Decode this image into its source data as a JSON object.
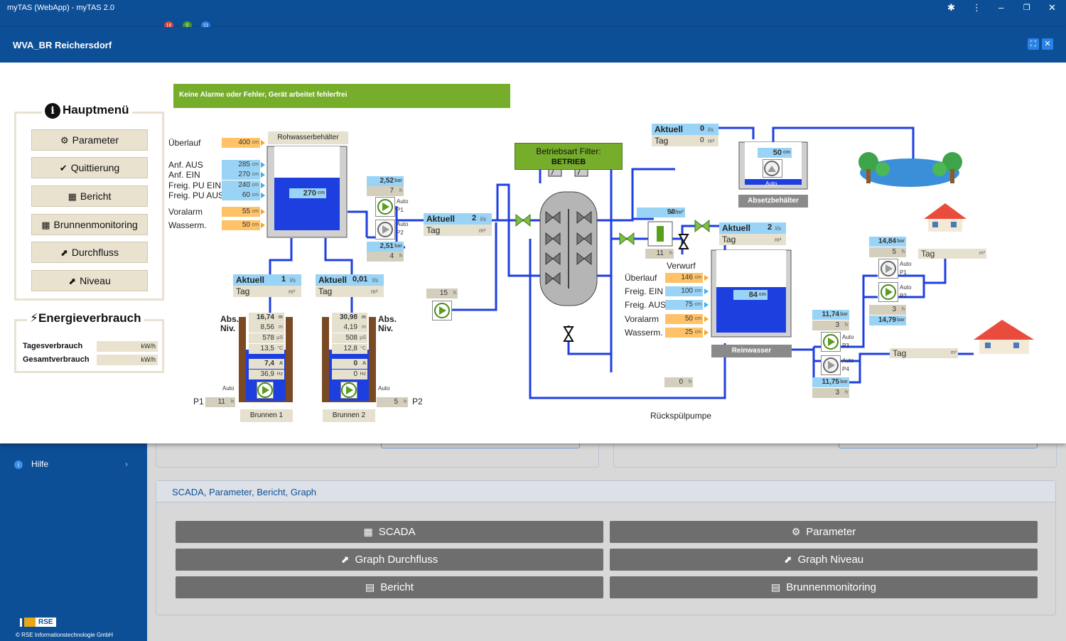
{
  "window": {
    "title": "myTAS (WebApp) - myTAS 2.0",
    "badges": [
      "16",
      "0",
      "11"
    ]
  },
  "sidebar": {
    "help_label": "Hilfe",
    "logo_text": "RSE",
    "copyright": "© RSE Informationstechnologie GmbH"
  },
  "scada_panel": {
    "title": "SCADA, Parameter, Bericht, Graph",
    "buttons": [
      "SCADA",
      "Parameter",
      "Graph Durchfluss",
      "Graph Niveau",
      "Bericht",
      "Brunnenmonitoring"
    ]
  },
  "modal": {
    "title": "WVA_BR Reichersdorf"
  },
  "main_menu": {
    "title": "Hauptmenü",
    "items": [
      "Parameter",
      "Quittierung",
      "Bericht",
      "Brunnenmonitoring",
      "Durchfluss",
      "Niveau"
    ]
  },
  "energy": {
    "title": "Energieverbrauch",
    "daily_label": "Tagesverbrauch",
    "total_label": "Gesamtverbrauch",
    "unit": "kW/h"
  },
  "alarm": {
    "text": "Keine Alarme oder Fehler, Gerät arbeitet fehlerfrei",
    "color": "#76ae2b"
  },
  "raw_tank": {
    "title": "Rohwasserbehälter",
    "level": "270",
    "unit": "cm",
    "params": [
      {
        "label": "Überlauf",
        "value": "400",
        "unit": "cm",
        "color": "orange"
      },
      {
        "label": "Anf. AUS",
        "value": "285",
        "unit": "cm",
        "color": "blue"
      },
      {
        "label": "Anf. EIN",
        "value": "270",
        "unit": "cm",
        "color": "blue"
      },
      {
        "label": "Freig. PU EIN",
        "value": "240",
        "unit": "cm",
        "color": "blue"
      },
      {
        "label": "Freig. PU AUS",
        "value": "60",
        "unit": "cm",
        "color": "blue"
      },
      {
        "label": "Voralarm",
        "value": "55",
        "unit": "cm",
        "color": "orange"
      },
      {
        "label": "Wasserm.",
        "value": "50",
        "unit": "cm",
        "color": "orange"
      }
    ]
  },
  "raw_pumps": {
    "p1_pressure": "2,52",
    "p1_hours": "7",
    "p2_pressure": "2,51",
    "p2_hours": "4",
    "pressure_unit": "bar",
    "hours_unit": "h",
    "auto": "Auto",
    "p1": "P1",
    "p2": "P2"
  },
  "flow_main": {
    "aktuell_label": "Aktuell",
    "aktuell_value": "2",
    "aktuell_unit": "l/s",
    "tag_label": "Tag",
    "tag_unit": "m³"
  },
  "well1": {
    "name": "Brunnen 1",
    "abs_label_1": "Abs.",
    "abs_label_2": "Niv.",
    "aktuell_label": "Aktuell",
    "aktuell_value": "1",
    "aktuell_unit": "l/s",
    "tag_label": "Tag",
    "tag_unit": "m³",
    "readings": [
      {
        "value": "16,74",
        "unit": "m"
      },
      {
        "value": "8,56",
        "unit": "m"
      },
      {
        "value": "578",
        "unit": "µS"
      },
      {
        "value": "13,5",
        "unit": "°C"
      },
      {
        "value": "7,4",
        "unit": "A"
      },
      {
        "value": "36,9",
        "unit": "Hz"
      }
    ],
    "auto": "Auto",
    "pump_label": "P1",
    "hours": "11",
    "hours_unit": "h"
  },
  "well2": {
    "name": "Brunnen 2",
    "abs_label_1": "Abs.",
    "abs_label_2": "Niv.",
    "aktuell_label": "Aktuell",
    "aktuell_value": "0,01",
    "aktuell_unit": "l/s",
    "tag_label": "Tag",
    "tag_unit": "m³",
    "readings": [
      {
        "value": "30,98",
        "unit": "m"
      },
      {
        "value": "4,19",
        "unit": "m"
      },
      {
        "value": "508",
        "unit": "µS"
      },
      {
        "value": "12,8",
        "unit": "°C"
      },
      {
        "value": "0",
        "unit": "A"
      },
      {
        "value": "0",
        "unit": "Hz"
      }
    ],
    "auto": "Auto",
    "pump_label": "P2",
    "hours": "5",
    "hours_unit": "h"
  },
  "aux_pump": {
    "hours": "15",
    "hours_unit": "h"
  },
  "filter": {
    "line1": "Betriebsart Filter:",
    "line2": "BETRIEB"
  },
  "absetz": {
    "title": "Absetzbehälter",
    "level": "50",
    "unit": "cm",
    "auto": "Auto",
    "aktuell_label": "Aktuell",
    "aktuell_value": "0",
    "aktuell_unit": "l/s",
    "tag_label": "Tag",
    "tag_value": "0",
    "tag_unit": "m³"
  },
  "uv": {
    "value": "90",
    "unit": "W/m²",
    "hours": "11",
    "hours_unit": "h"
  },
  "verwurf": {
    "label": "Verwurf"
  },
  "flow_rein": {
    "aktuell_label": "Aktuell",
    "aktuell_value": "2",
    "aktuell_unit": "l/s",
    "tag_label": "Tag",
    "tag_unit": "m³"
  },
  "reinwasser": {
    "title": "Reinwasser",
    "level": "84",
    "unit": "cm",
    "params": [
      {
        "label": "Überlauf",
        "value": "146",
        "unit": "cm",
        "color": "orange"
      },
      {
        "label": "Freig. EIN",
        "value": "100",
        "unit": "cm",
        "color": "blue"
      },
      {
        "label": "Freig. AUS",
        "value": "75",
        "unit": "cm",
        "color": "blue"
      },
      {
        "label": "Voralarm",
        "value": "50",
        "unit": "cm",
        "color": "orange"
      },
      {
        "label": "Wasserm.",
        "value": "25",
        "unit": "cm",
        "color": "orange"
      }
    ]
  },
  "backwash": {
    "label": "Rückspülpumpe",
    "hours": "0",
    "hours_unit": "h"
  },
  "upper_pumps": {
    "pressure_top": "14,84",
    "hours_p1": "5",
    "hours_p2": "3",
    "pressure_bottom": "14,79",
    "pressure_unit": "bar",
    "hours_unit": "h",
    "auto": "Auto",
    "p1": "P1",
    "p2": "P2",
    "tag_label": "Tag",
    "tag_unit": "m³"
  },
  "lower_pumps": {
    "pressure_top": "11,74",
    "hours_p3": "3",
    "pressure_bottom": "11,75",
    "hours_p4": "3",
    "pressure_unit": "bar",
    "hours_unit": "h",
    "auto": "Auto",
    "p3": "P3",
    "p4": "P4",
    "tag_label": "Tag",
    "tag_unit": "m³"
  },
  "colors": {
    "pipe": "#1e3fe0",
    "water": "#1e3fe0",
    "header": "#0d4f97",
    "orange": "#ffc266",
    "blue": "#99d3f5",
    "beige": "#e6e0cf"
  }
}
